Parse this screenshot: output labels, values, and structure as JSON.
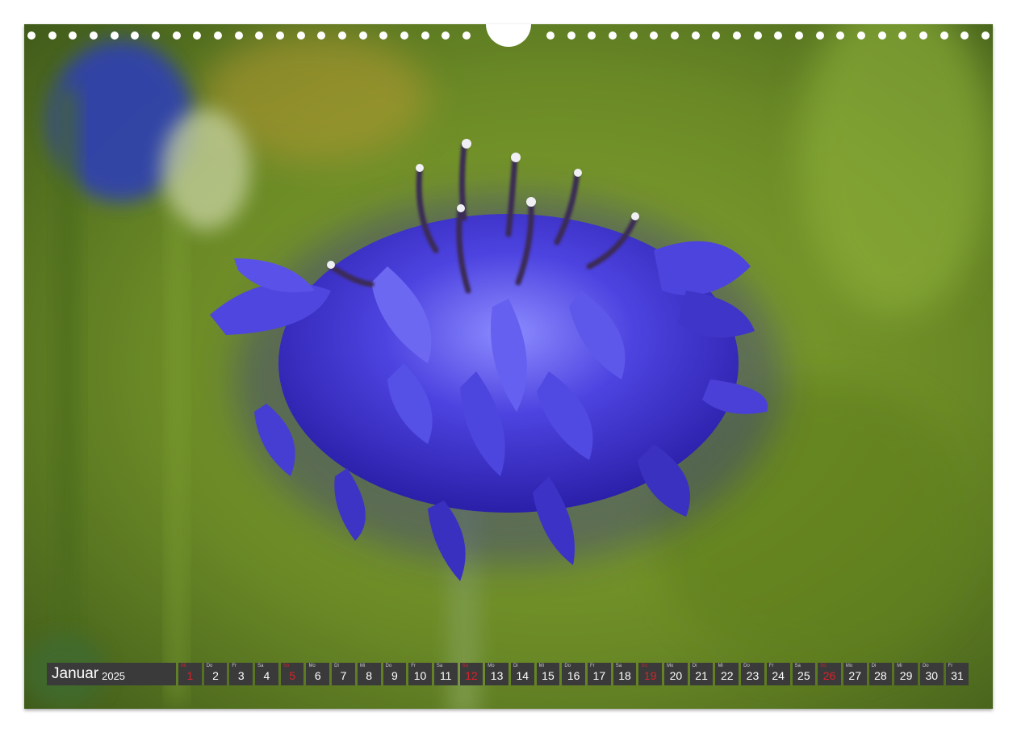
{
  "calendar": {
    "month": "Januar",
    "year": "2025",
    "days": [
      {
        "wd": "Mi",
        "num": "1",
        "sunday": true
      },
      {
        "wd": "Do",
        "num": "2",
        "sunday": false
      },
      {
        "wd": "Fr",
        "num": "3",
        "sunday": false
      },
      {
        "wd": "Sa",
        "num": "4",
        "sunday": false
      },
      {
        "wd": "So",
        "num": "5",
        "sunday": true
      },
      {
        "wd": "Mo",
        "num": "6",
        "sunday": false
      },
      {
        "wd": "Di",
        "num": "7",
        "sunday": false
      },
      {
        "wd": "Mi",
        "num": "8",
        "sunday": false
      },
      {
        "wd": "Do",
        "num": "9",
        "sunday": false
      },
      {
        "wd": "Fr",
        "num": "10",
        "sunday": false
      },
      {
        "wd": "Sa",
        "num": "11",
        "sunday": false
      },
      {
        "wd": "So",
        "num": "12",
        "sunday": true
      },
      {
        "wd": "Mo",
        "num": "13",
        "sunday": false
      },
      {
        "wd": "Di",
        "num": "14",
        "sunday": false
      },
      {
        "wd": "Mi",
        "num": "15",
        "sunday": false
      },
      {
        "wd": "Do",
        "num": "16",
        "sunday": false
      },
      {
        "wd": "Fr",
        "num": "17",
        "sunday": false
      },
      {
        "wd": "Sa",
        "num": "18",
        "sunday": false
      },
      {
        "wd": "So",
        "num": "19",
        "sunday": true
      },
      {
        "wd": "Mo",
        "num": "20",
        "sunday": false
      },
      {
        "wd": "Di",
        "num": "21",
        "sunday": false
      },
      {
        "wd": "Mi",
        "num": "22",
        "sunday": false
      },
      {
        "wd": "Do",
        "num": "23",
        "sunday": false
      },
      {
        "wd": "Fr",
        "num": "24",
        "sunday": false
      },
      {
        "wd": "Sa",
        "num": "25",
        "sunday": false
      },
      {
        "wd": "So",
        "num": "26",
        "sunday": true
      },
      {
        "wd": "Mo",
        "num": "27",
        "sunday": false
      },
      {
        "wd": "Di",
        "num": "28",
        "sunday": false
      },
      {
        "wd": "Mi",
        "num": "29",
        "sunday": false
      },
      {
        "wd": "Do",
        "num": "30",
        "sunday": false
      },
      {
        "wd": "Fr",
        "num": "31",
        "sunday": false
      }
    ]
  },
  "colors": {
    "background_green": "#6f8e2a",
    "flower_blue": "#4a3fd6",
    "holiday_red": "#d8232a",
    "strip_gray": "#3a3a3a"
  }
}
